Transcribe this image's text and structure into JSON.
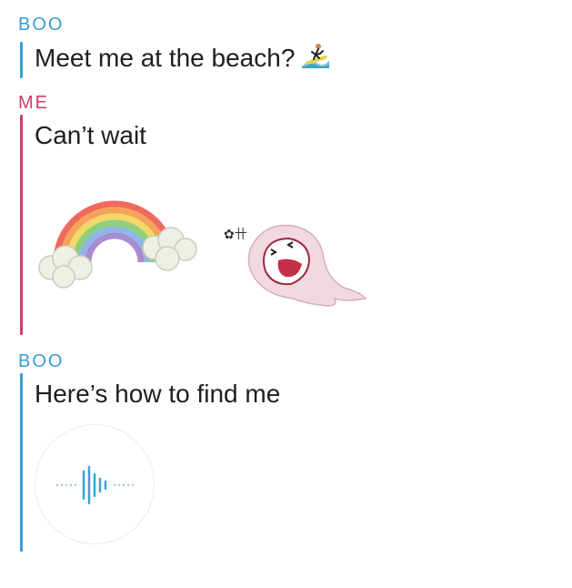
{
  "messages": [
    {
      "sender": "BOO",
      "text": "Meet me at the beach?",
      "emoji": "surfer-emoji"
    },
    {
      "sender": "ME",
      "text": "Can’t wait"
    },
    {
      "sender": "BOO",
      "text": "Here’s how to find me"
    }
  ],
  "stickers": [
    "rainbow-sticker",
    "laughing-ghost-sticker"
  ],
  "voice_note": {
    "icon": "audio-waveform-icon"
  },
  "colors": {
    "boo": "#3a9fd3",
    "me": "#d03b6d",
    "text": "#1f1f1f"
  }
}
